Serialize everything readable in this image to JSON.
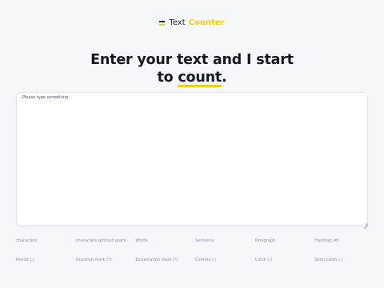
{
  "header": {
    "logo_word1": "Text",
    "logo_word2": "Counter"
  },
  "hero": {
    "line1": "Enter your text and I start",
    "line2_prefix": "to",
    "line2_highlight": "count",
    "line2_suffix": "."
  },
  "editor": {
    "placeholder": "Please type something",
    "value": ""
  },
  "stats": {
    "row1": [
      "characters",
      "characters without space",
      "Words",
      "Sentence",
      "Paragraph",
      "Hashtag (#)"
    ],
    "row2": [
      "Period (.)",
      "Question mark (?)",
      "Exclamation mark (!)",
      "Comma (,)",
      "Colon (:)",
      "Semi-colon (;)"
    ]
  },
  "colors": {
    "accent": "#f5cc16",
    "text_dark": "#151821",
    "background": "#f6f7fb"
  }
}
